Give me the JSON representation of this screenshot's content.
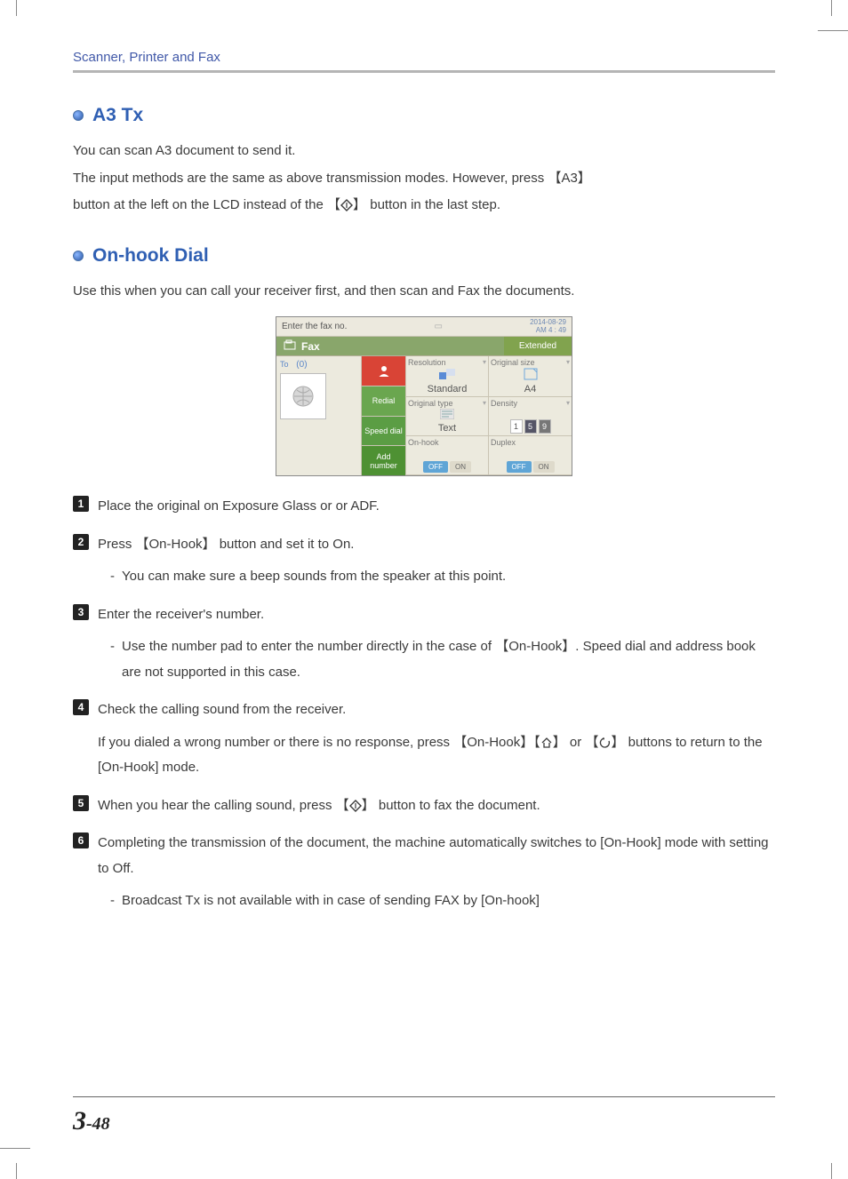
{
  "header": {
    "running_head": "Scanner, Printer and Fax"
  },
  "section_a3": {
    "title": "A3 Tx",
    "p1": "You can scan A3 document to send it.",
    "p2_pre": "The input methods are the same as above transmission modes. However, press ",
    "p2_a3": "【A3】",
    "p2_post": "",
    "p3_pre": "button at the left on the LCD instead of the ",
    "p3_start_bracket": "【",
    "p3_end_bracket": "】",
    "p3_post": " button in the last step."
  },
  "section_onhook": {
    "title": "On-hook Dial",
    "intro": "Use this when you can call your receiver first, and then scan and Fax the documents."
  },
  "ui": {
    "top_prompt": "Enter the fax no.",
    "top_date": "2014-08-29",
    "top_time": "AM 4 : 49",
    "title": "Fax",
    "extended": "Extended",
    "to_label": "To",
    "to_count": "(0)",
    "btn_addressbook": "",
    "btn_redial": "Redial",
    "btn_speed": "Speed dial",
    "btn_addnum": "Add number",
    "cells": {
      "resolution": {
        "label": "Resolution",
        "value": "Standard"
      },
      "orig_size": {
        "label": "Original size",
        "value": "A4"
      },
      "orig_type": {
        "label": "Original type",
        "value": "Text"
      },
      "density": {
        "label": "Density",
        "v1": "1",
        "v2": "5",
        "v3": "9"
      },
      "onhook": {
        "label": "On-hook",
        "off": "OFF",
        "on": "ON"
      },
      "duplex": {
        "label": "Duplex",
        "off": "OFF",
        "on": "ON"
      }
    }
  },
  "steps": {
    "s1": "Place the original on Exposure Glass or or ADF.",
    "s2_main": "Press 【On-Hook】 button and set it to On.",
    "s2_sub": "You can make sure a beep sounds from the speaker at this point.",
    "s3_main": "Enter the receiver's number.",
    "s3_sub": "Use the number pad to enter the number directly in the case of 【On-Hook】. Speed dial and address book are not supported in this case.",
    "s4_main": "Check the calling sound from the receiver.",
    "s4_sub_pre": "If you dialed a wrong number or there is no response, press 【On-Hook】",
    "s4_sub_mid": "【",
    "s4_sub_mid_close": "】 or 【",
    "s4_sub_mid2_close": "】",
    "s4_sub_post": " buttons to return to the [On-Hook] mode.",
    "s5_pre": "When you hear the calling sound, press ",
    "s5_b1": "【",
    "s5_b2": "】",
    "s5_post": " button to fax the document.",
    "s6_main": "Completing the transmission of the document, the machine automatically switches to [On-Hook] mode with setting to Off.",
    "s6_sub": "Broadcast Tx is not available with in case of sending FAX by [On-hook]"
  },
  "footer": {
    "chapter": "3",
    "page": "-48"
  }
}
